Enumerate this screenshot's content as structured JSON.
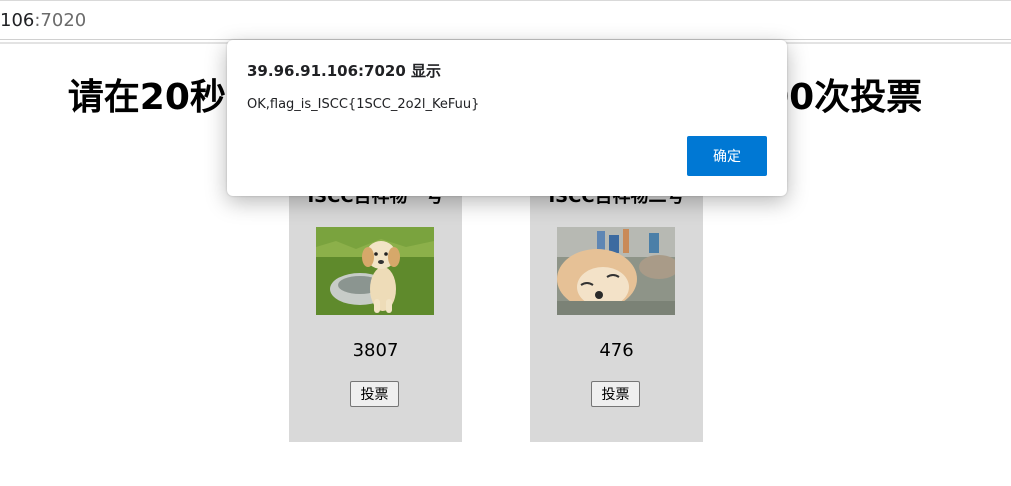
{
  "browser": {
    "url_host": "106",
    "url_port": ":7020"
  },
  "page": {
    "heading": "请在20秒内为你心目中的ISCC吉祥物投3000次投票",
    "cards": [
      {
        "title": "ISCC吉祥物一号",
        "image_icon": "puppy-photo",
        "votes": "3807",
        "vote_label": "投票"
      },
      {
        "title": "ISCC吉祥物二号",
        "image_icon": "shiba-photo",
        "votes": "476",
        "vote_label": "投票"
      }
    ]
  },
  "dialog": {
    "title": "39.96.91.106:7020 显示",
    "message": "OK,flag_is_ISCC{1SCC_2o2l_KeFuu}",
    "ok_label": "确定",
    "accent_color": "#0078d4"
  }
}
